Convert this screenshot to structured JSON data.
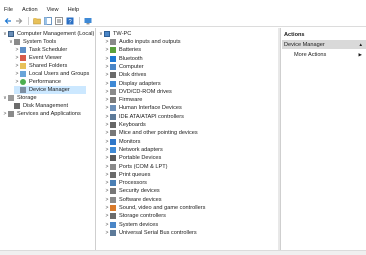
{
  "menu": [
    "File",
    "Action",
    "View",
    "Help"
  ],
  "toolbar": [
    "back-arrow-icon",
    "forward-arrow-icon",
    "folder-up-icon",
    "show-hide-tree-icon",
    "properties-icon",
    "help-icon",
    "console-icon"
  ],
  "left_tree": [
    {
      "label": "Computer Management (Local)",
      "icon": "computer-management-icon",
      "expander": "∨",
      "indent": 0
    },
    {
      "label": "System Tools",
      "icon": "system-tools-icon",
      "expander": "∨",
      "indent": 1
    },
    {
      "label": "Task Scheduler",
      "icon": "task-scheduler-icon",
      "expander": ">",
      "indent": 2
    },
    {
      "label": "Event Viewer",
      "icon": "event-viewer-icon",
      "expander": ">",
      "indent": 2
    },
    {
      "label": "Shared Folders",
      "icon": "shared-folders-icon",
      "expander": ">",
      "indent": 2
    },
    {
      "label": "Local Users and Groups",
      "icon": "local-users-icon",
      "expander": ">",
      "indent": 2
    },
    {
      "label": "Performance",
      "icon": "performance-icon",
      "expander": ">",
      "indent": 2
    },
    {
      "label": "Device Manager",
      "icon": "device-manager-icon",
      "expander": "",
      "indent": 2,
      "selected": true
    },
    {
      "label": "Storage",
      "icon": "storage-icon",
      "expander": "∨",
      "indent": 1
    },
    {
      "label": "Disk Management",
      "icon": "disk-management-icon",
      "expander": "",
      "indent": 2
    },
    {
      "label": "Services and Applications",
      "icon": "services-icon",
      "expander": ">",
      "indent": 1
    }
  ],
  "device_tree": {
    "root": {
      "label": "TW-PC",
      "icon": "computer-icon"
    },
    "categories": [
      {
        "label": "Audio inputs and outputs",
        "icon": "audio-icon"
      },
      {
        "label": "Batteries",
        "icon": "battery-icon"
      },
      {
        "label": "Bluetooth",
        "icon": "bluetooth-icon"
      },
      {
        "label": "Computer",
        "icon": "computer-icon"
      },
      {
        "label": "Disk drives",
        "icon": "disk-drive-icon"
      },
      {
        "label": "Display adapters",
        "icon": "display-adapter-icon"
      },
      {
        "label": "DVD/CD-ROM drives",
        "icon": "dvd-icon"
      },
      {
        "label": "Firmware",
        "icon": "firmware-icon"
      },
      {
        "label": "Human Interface Devices",
        "icon": "hid-icon"
      },
      {
        "label": "IDE ATA/ATAPI controllers",
        "icon": "ide-controller-icon"
      },
      {
        "label": "Keyboards",
        "icon": "keyboard-icon"
      },
      {
        "label": "Mice and other pointing devices",
        "icon": "mouse-icon"
      },
      {
        "label": "Monitors",
        "icon": "monitor-icon"
      },
      {
        "label": "Network adapters",
        "icon": "network-adapter-icon"
      },
      {
        "label": "Portable Devices",
        "icon": "portable-device-icon"
      },
      {
        "label": "Ports (COM & LPT)",
        "icon": "port-icon"
      },
      {
        "label": "Print queues",
        "icon": "printer-icon"
      },
      {
        "label": "Processors",
        "icon": "processor-icon"
      },
      {
        "label": "Security devices",
        "icon": "security-device-icon"
      },
      {
        "label": "Software devices",
        "icon": "software-device-icon"
      },
      {
        "label": "Sound, video and game controllers",
        "icon": "sound-icon"
      },
      {
        "label": "Storage controllers",
        "icon": "storage-controller-icon"
      },
      {
        "label": "System devices",
        "icon": "system-device-icon"
      },
      {
        "label": "Universal Serial Bus controllers",
        "icon": "usb-icon"
      }
    ]
  },
  "actions": {
    "header": "Actions",
    "section": "Device Manager",
    "section_arrow": "▲",
    "item": "More Actions",
    "item_arrow": "▶"
  },
  "colors": {
    "selection": "#cce8ff",
    "section_bg": "#d9d9d9",
    "accent": "#1e78d2"
  }
}
